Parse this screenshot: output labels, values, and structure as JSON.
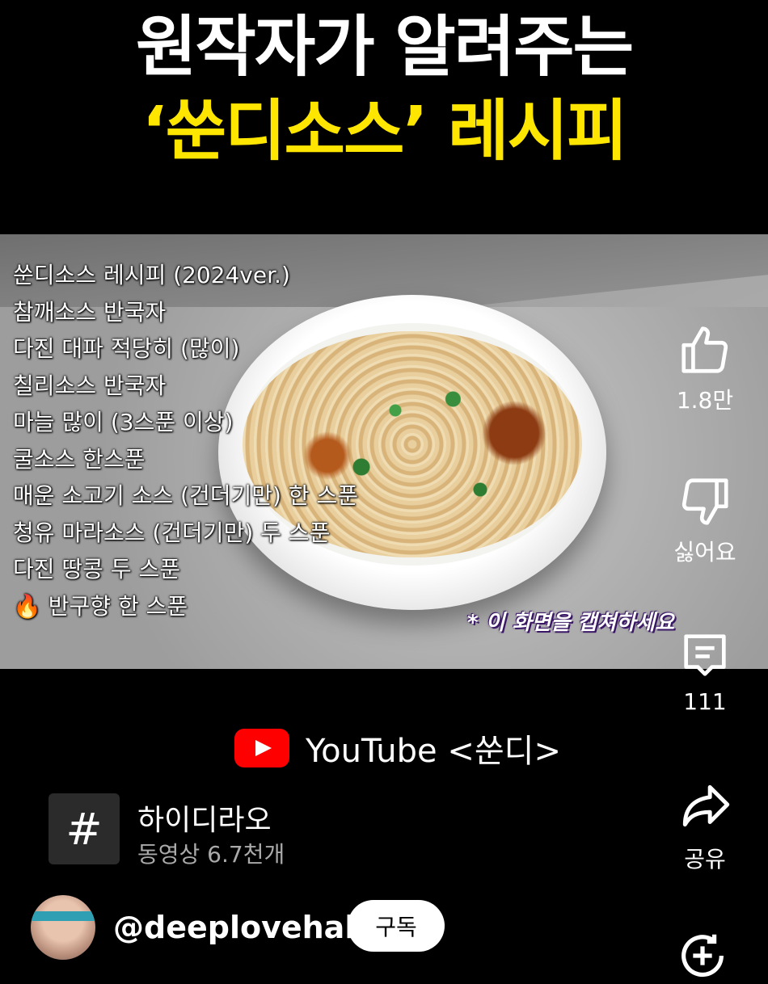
{
  "headline": {
    "line1": "원작자가 알려주는",
    "line2": "‘쑨디소스’ 레시피"
  },
  "video": {
    "recipe_title": "쑨디소스 레시피 (2024ver.)",
    "recipe_items": [
      "참깨소스 반국자",
      "다진 대파 적당히 (많이)",
      "칠리소스 반국자",
      "마늘 많이 (3스푼 이상)",
      "굴소스 한스푼",
      "매운 소고기 소스 (건더기만) 한 스푼",
      "청유 마라소스 (건더기만) 두 스푼",
      "다진 땅콩 두 스푼",
      "🔥 반구향 한 스푼"
    ],
    "capture_note": "* 이 화면을 캡쳐하세요"
  },
  "youtube_credit": {
    "icon": "youtube-logo-icon",
    "text": "YouTube <쑨디>"
  },
  "actions": {
    "like_count": "1.8만",
    "dislike_label": "싫어요",
    "comment_count": "111",
    "share_label": "공유"
  },
  "hashtag": {
    "symbol": "#",
    "name": "하이디라오",
    "video_count": "동영상 6.7천개"
  },
  "channel": {
    "handle": "@deeplovehalf",
    "subscribe_label": "구독"
  }
}
